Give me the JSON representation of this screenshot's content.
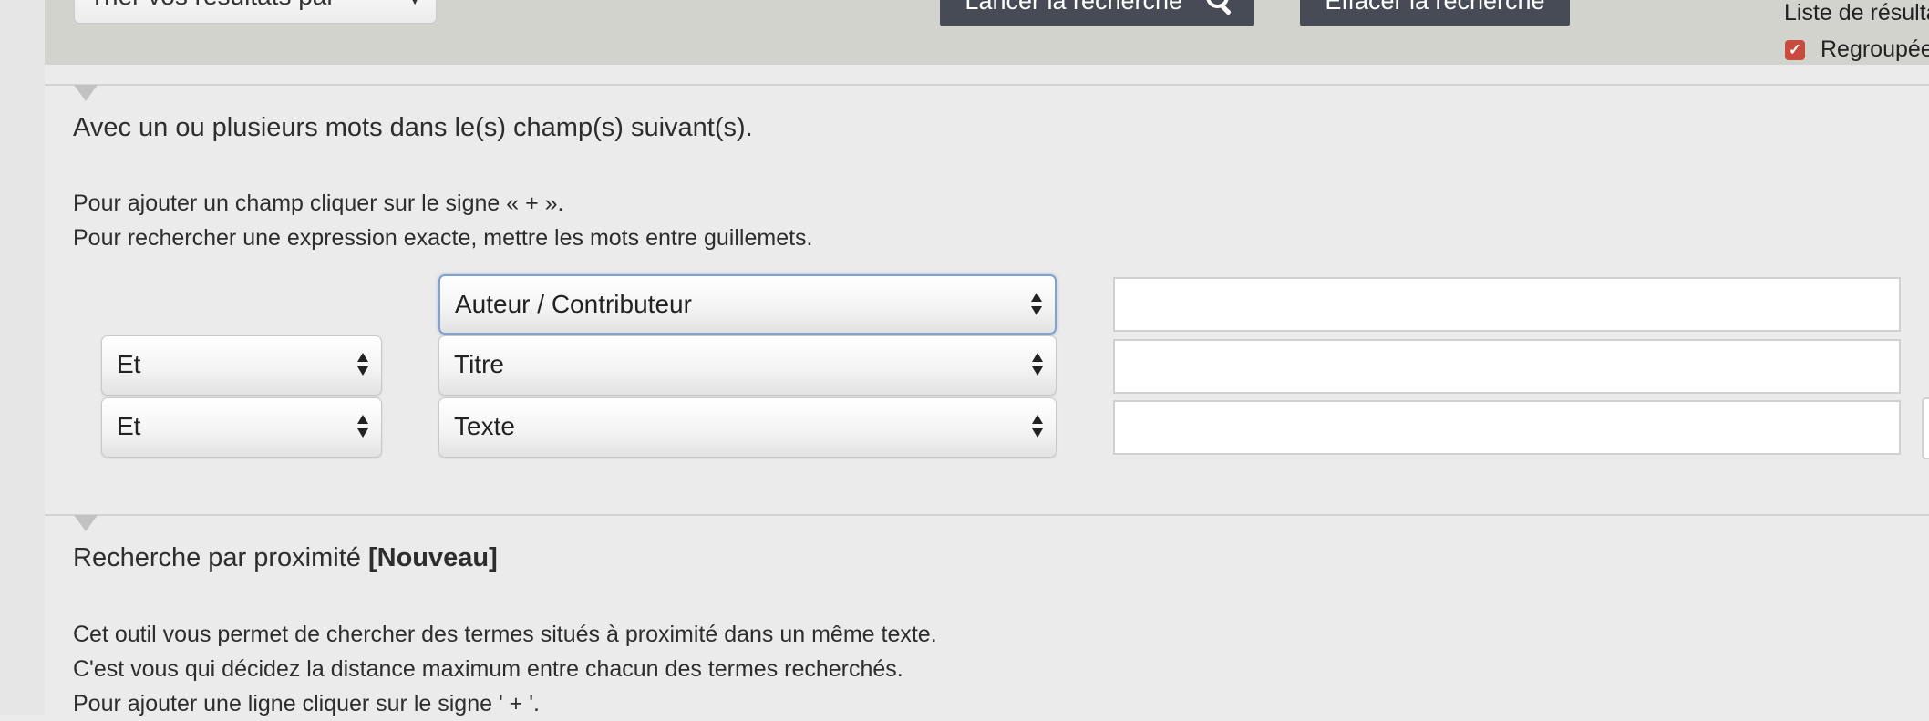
{
  "toolbar": {
    "sort_select_value": "Trier vos résultats par",
    "search_button_label": "Lancer la recherche",
    "search_icon": "search-icon",
    "clear_button_label": "Effacer la recherche"
  },
  "results": {
    "list_label": "Liste de résulta",
    "grouped_checkbox_checked": true,
    "grouped_label": "Regroupée",
    "checkbox_color": "#c84b3e"
  },
  "section_fields": {
    "heading": "Avec un ou plusieurs mots dans le(s) champ(s) suivant(s).",
    "help_line1": "Pour ajouter un champ cliquer sur le signe « + ».",
    "help_line2": "Pour rechercher une expression exacte, mettre les mots entre guillemets.",
    "rows": [
      {
        "operator": null,
        "field": "Auteur / Contributeur",
        "value": ""
      },
      {
        "operator": "Et",
        "field": "Titre",
        "value": ""
      },
      {
        "operator": "Et",
        "field": "Texte",
        "value": ""
      }
    ]
  },
  "section_proximity": {
    "heading": "Recherche par proximité",
    "badge": "[Nouveau]",
    "line1": "Cet outil vous permet de chercher des termes situés à proximité dans un même texte.",
    "line2": "C'est vous qui décidez la distance maximum entre chacun des termes recherchés.",
    "line3": "Pour ajouter une ligne cliquer sur le signe ' + '."
  },
  "colors": {
    "page_bg": "#ebebeb",
    "top_band_bg": "#d3d3ce",
    "dark_button_bg": "#464b55",
    "focus_border": "#7ea3d1"
  }
}
